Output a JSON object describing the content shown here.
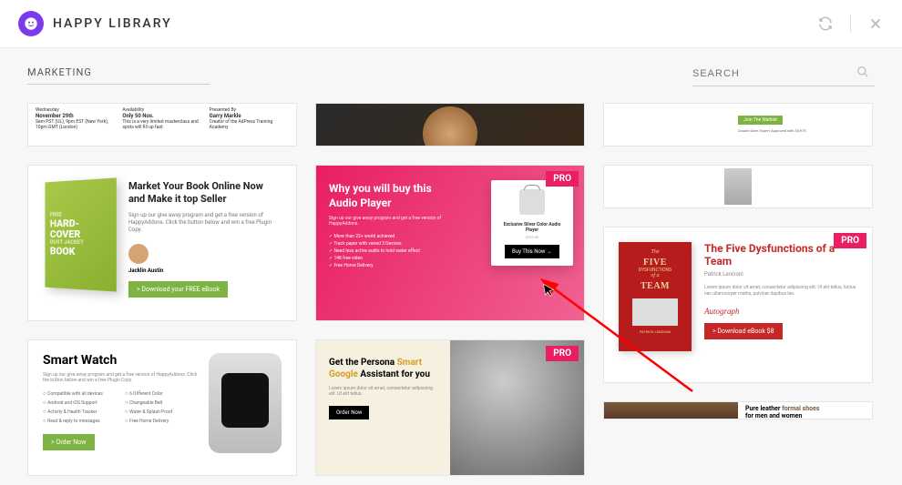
{
  "header": {
    "title": "HAPPY LIBRARY"
  },
  "filter": {
    "category": "MARKETING",
    "search_placeholder": "SEARCH"
  },
  "cut_card": {
    "c1": {
      "line1": "Wednesday",
      "line2": "November 29th",
      "line3": "Sem PST (UL), 9pm EST (New York), 10pm GMT (London)"
    },
    "c2": {
      "line1": "Availability",
      "line2": "Only 50 Nos.",
      "line3": "This is a very limited masterclass and spots will fill up fast"
    },
    "c3": {
      "line1": "Presented By",
      "line2": "Garry Markle",
      "line3": "Creator of the AdPress Training Academy"
    }
  },
  "join_card": {
    "btn": "Join The Waitlist",
    "sub": "Double Dare: Expert Approved with $5,975"
  },
  "book_card": {
    "img_line1": "FREE",
    "img_line2": "HARD-",
    "img_line3": "COVER",
    "img_line4": "DUST JACKET",
    "img_line5": "BOOK",
    "title": "Market Your Book Online Now and Make it top Seller",
    "desc": "Sign up our give away program and get a free version of HappyAddons. Click the button below and win a free Plugin Copy.",
    "author": "Jacklin Austin",
    "btn": "> Download your FREE eBook"
  },
  "audio_card": {
    "title": "Why you will buy this Audio Player",
    "desc": "Sign up our give away program and get a free version of HappyAddons.",
    "feat1": "More than 22+ world achieved",
    "feat2": "Track paper with varied 3 Devices",
    "feat3": "Need less active audio to hold water effect",
    "feat4": "148 free video",
    "feat5": "Free Home Delivery",
    "pro": "PRO",
    "popup_text": "Exclusive Silver Color Audio Player",
    "popup_sub": "$239.00",
    "popup_btn": "Buy This Now →"
  },
  "five_card": {
    "pro": "PRO",
    "book_the": "The",
    "book_main1": "FIVE",
    "book_main2": "DYSFUNCTIONS",
    "book_of": "of a",
    "book_main3": "TEAM",
    "book_author": "PATRICK LENCIONI",
    "title": "The Five Dysfunctions of a Team",
    "author": "Patrick Lencioni",
    "desc": "Lorem ipsum dolor sit amet, consectetur adipiscing elit. Ut elit tellus, luctus nec ullamcorper mattis, pulvinar dapibus leo.",
    "sig": "Autograph",
    "btn": "> Download eBook $8"
  },
  "watch_card": {
    "title": "Smart Watch",
    "desc": "Sign up our give away program and get a free version of HappyAddons. Click the button below and win a free Plugin Copy.",
    "f1": "Compatible with all devices",
    "f2": "Android and iOS Support",
    "f3": "Activity & Health Tracker",
    "f4": "Read & reply to messages",
    "f5": "6 Different Color",
    "f6": "Changeable Belt",
    "f7": "Water & Splash Proof",
    "f8": "Free Home Delivery",
    "btn": "> Order Now"
  },
  "persona_card": {
    "pro": "PRO",
    "title_p1": "Get the Persona ",
    "title_accent": "Smart Google",
    "title_p2": " Assistant for you",
    "desc": "Lorem ipsum dolor sit amet, consectetur adipiscing elit. Ut elit tellus.",
    "btn": "Order Now"
  },
  "leather_card": {
    "title_p1": "Pure leather ",
    "title_accent": "formal shoes",
    "title_p2": " for men and women"
  }
}
